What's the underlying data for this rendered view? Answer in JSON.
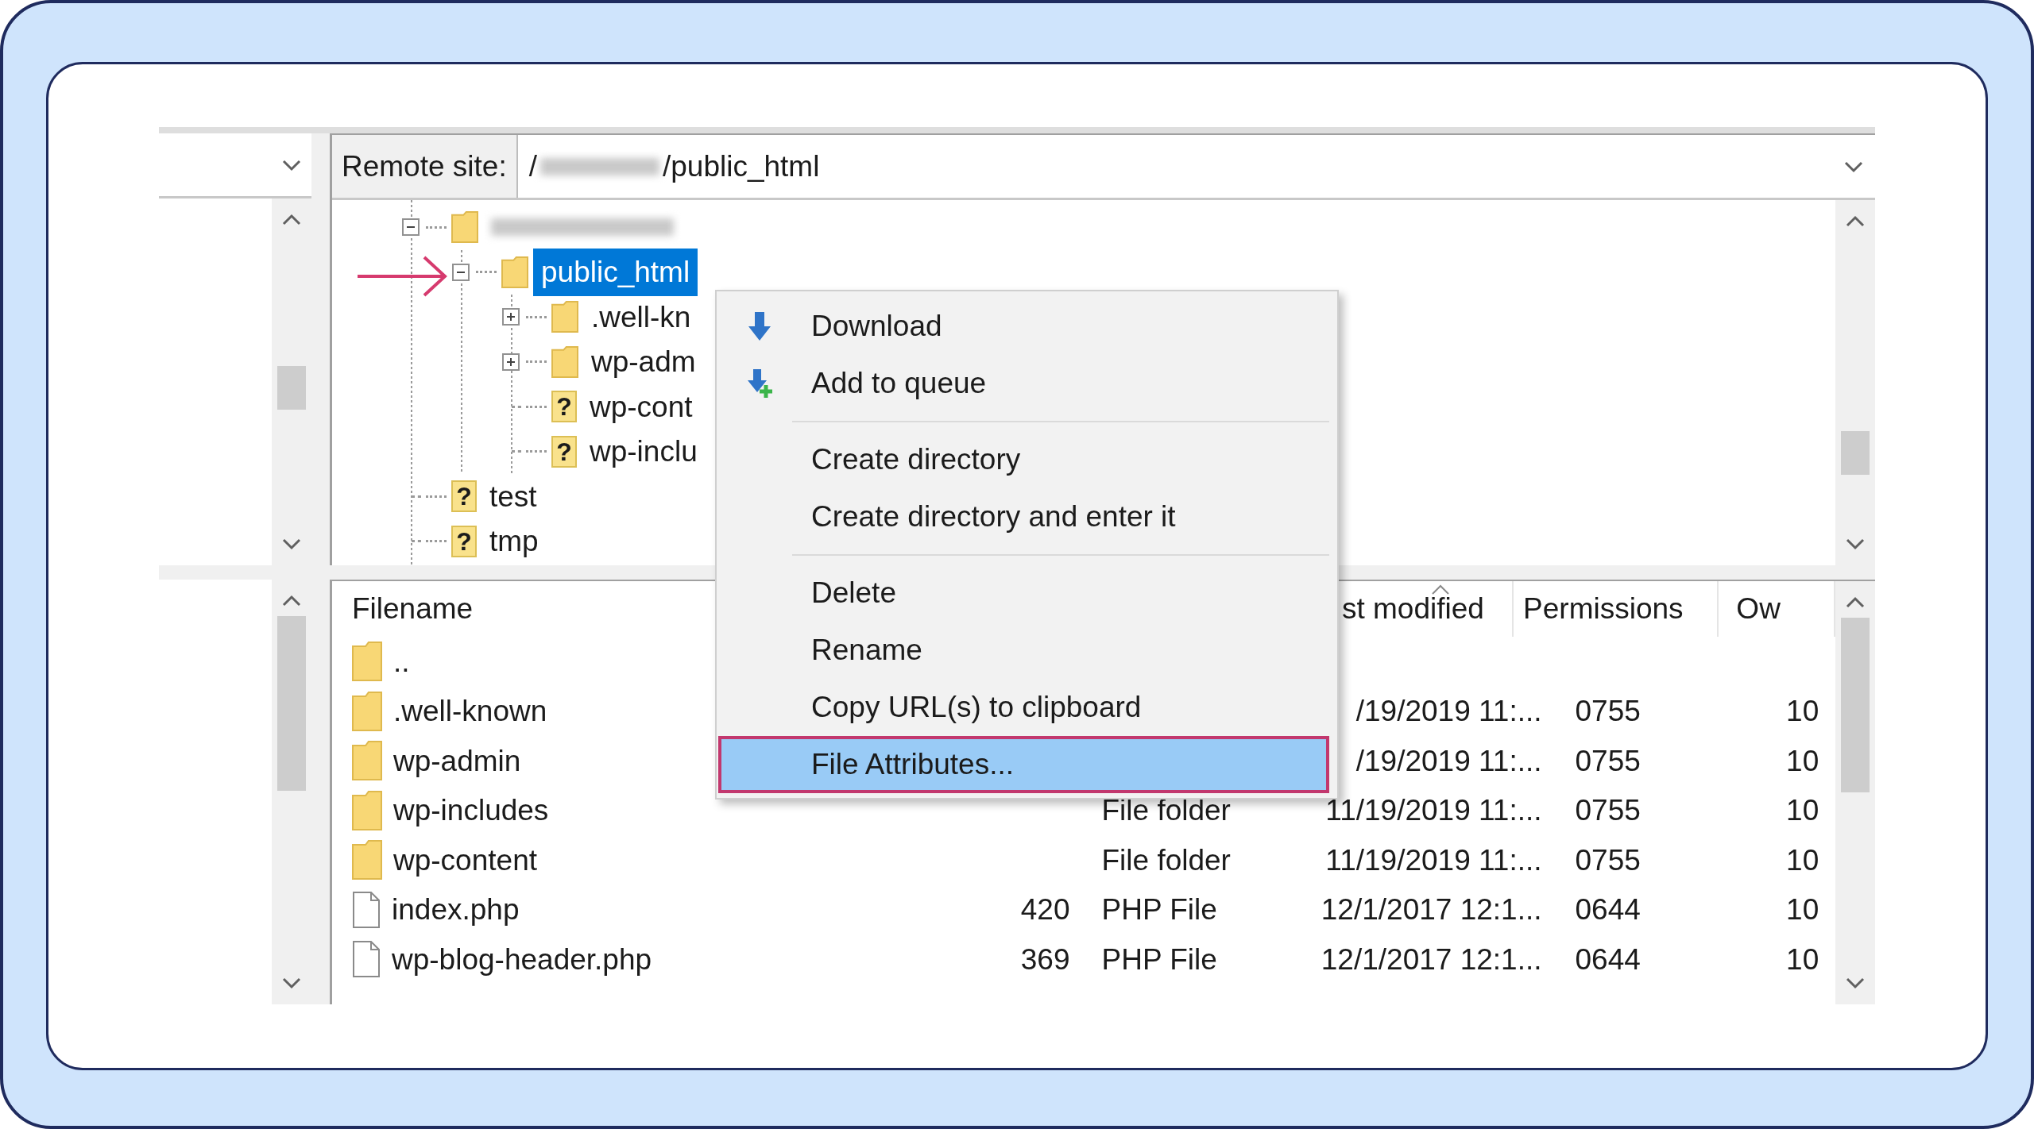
{
  "remote_site": {
    "label": "Remote site:",
    "path_prefix": "/",
    "path_redacted": true,
    "path_suffix": "/public_html"
  },
  "tree": [
    {
      "redacted": true,
      "expanded": true,
      "children": [
        {
          "label": "public_html",
          "expanded": true,
          "selected": true,
          "children": [
            {
              "label": ".well-kn",
              "expanded": false,
              "selected": false
            },
            {
              "label": "wp-adm",
              "expanded": false,
              "selected": false
            },
            {
              "label": "wp-cont",
              "glyph": "?",
              "selected": false
            },
            {
              "label": "wp-inclu",
              "glyph": "?",
              "selected": false
            }
          ]
        }
      ]
    },
    {
      "label": "test",
      "glyph": "?",
      "selected": false
    },
    {
      "label": "tmp",
      "glyph": "?",
      "selected": false
    }
  ],
  "context_menu": [
    {
      "kind": "item",
      "label": "Download",
      "selected": false
    },
    {
      "kind": "item",
      "label": "Add to queue",
      "selected": false
    },
    {
      "kind": "separator"
    },
    {
      "kind": "item",
      "label": "Create directory",
      "selected": false
    },
    {
      "kind": "item",
      "label": "Create directory and enter it",
      "selected": false
    },
    {
      "kind": "separator"
    },
    {
      "kind": "item",
      "label": "Delete",
      "selected": false
    },
    {
      "kind": "item",
      "label": "Rename",
      "selected": false
    },
    {
      "kind": "item",
      "label": "Copy URL(s) to clipboard",
      "selected": false
    },
    {
      "kind": "item",
      "label": "File Attributes...",
      "selected": true
    }
  ],
  "file_list": {
    "columns": [
      "Filename",
      "st modified",
      "Permissions",
      "Ow"
    ],
    "rows": [
      {
        "kind": "folder",
        "name": ".."
      },
      {
        "kind": "folder",
        "name": ".well-known",
        "modified": "/19/2019 11:...",
        "permissions": "0755",
        "owner": "10"
      },
      {
        "kind": "folder",
        "name": "wp-admin",
        "modified": "/19/2019 11:...",
        "permissions": "0755",
        "owner": "10"
      },
      {
        "kind": "folder",
        "name": "wp-includes",
        "type": "File folder",
        "modified": "11/19/2019 11:...",
        "permissions": "0755",
        "owner": "10"
      },
      {
        "kind": "folder",
        "name": "wp-content",
        "type": "File folder",
        "modified": "11/19/2019 11:...",
        "permissions": "0755",
        "owner": "10"
      },
      {
        "kind": "file",
        "name": "index.php",
        "size": "420",
        "type": "PHP File",
        "modified": "12/1/2017 12:1...",
        "permissions": "0644",
        "owner": "10"
      },
      {
        "kind": "file",
        "name": "wp-blog-header.php",
        "size": "369",
        "type": "PHP File",
        "modified": "12/1/2017 12:1...",
        "permissions": "0644",
        "owner": "10"
      }
    ]
  }
}
